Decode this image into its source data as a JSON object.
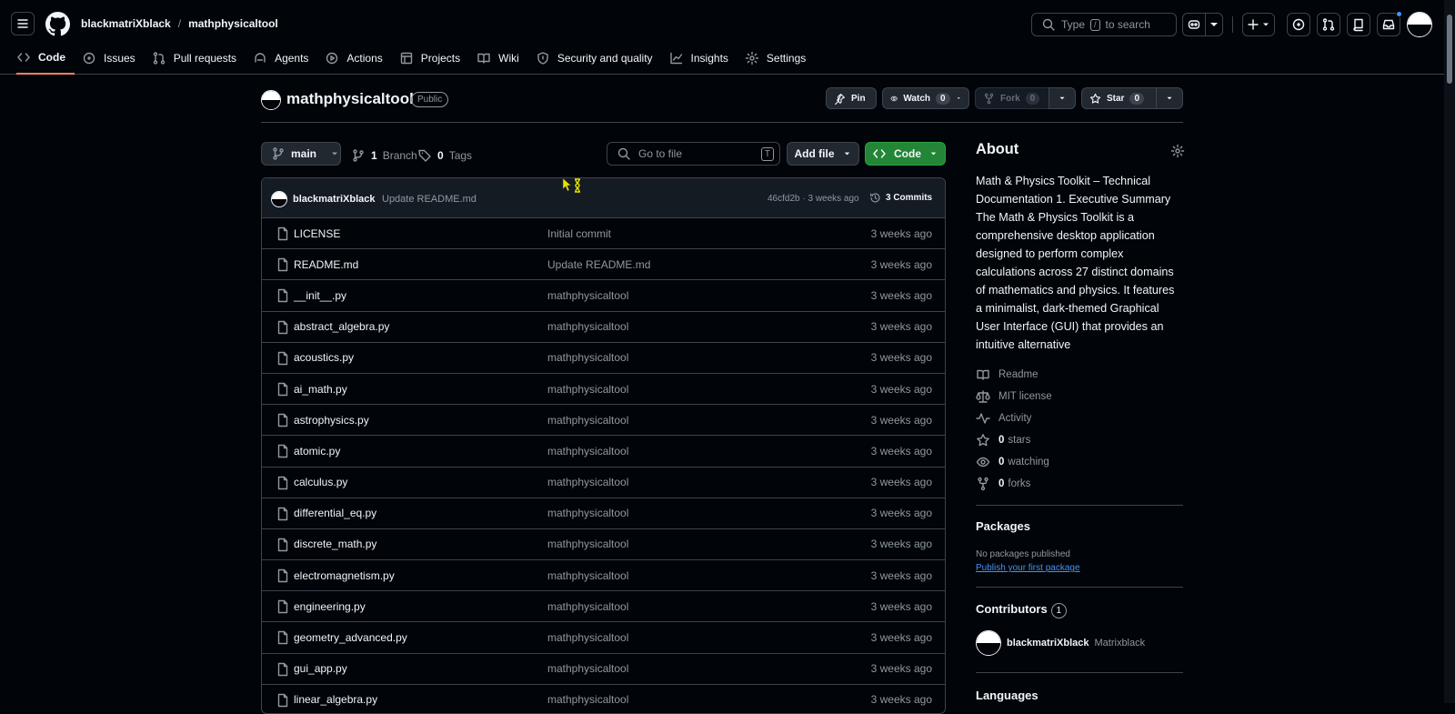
{
  "header": {
    "owner": "blackmatriXblack",
    "repo": "mathphysicaltool",
    "search_prefix": "Type",
    "search_key": "/",
    "search_suffix": "to search"
  },
  "tabs": [
    {
      "label": "Code"
    },
    {
      "label": "Issues"
    },
    {
      "label": "Pull requests"
    },
    {
      "label": "Agents"
    },
    {
      "label": "Actions"
    },
    {
      "label": "Projects"
    },
    {
      "label": "Wiki"
    },
    {
      "label": "Security and quality"
    },
    {
      "label": "Insights"
    },
    {
      "label": "Settings"
    }
  ],
  "repo": {
    "name": "mathphysicaltool",
    "visibility": "Public",
    "pin": "Pin",
    "watch": "Watch",
    "watch_count": "0",
    "fork": "Fork",
    "fork_count": "0",
    "star": "Star",
    "star_count": "0"
  },
  "toolbar": {
    "branch": "main",
    "branch_count": "1",
    "branch_label": "Branch",
    "tag_count": "0",
    "tag_label": "Tags",
    "goto_placeholder": "Go to file",
    "goto_key": "T",
    "add_file": "Add file",
    "code": "Code"
  },
  "latest_commit": {
    "author": "blackmatriXblack",
    "message": "Update README.md",
    "sha_age": "46cfd2b · 3 weeks ago",
    "commits": "3 Commits"
  },
  "files": [
    {
      "name": "LICENSE",
      "msg": "Initial commit",
      "date": "3 weeks ago"
    },
    {
      "name": "README.md",
      "msg": "Update README.md",
      "date": "3 weeks ago"
    },
    {
      "name": "__init__.py",
      "msg": "mathphysicaltool",
      "date": "3 weeks ago"
    },
    {
      "name": "abstract_algebra.py",
      "msg": "mathphysicaltool",
      "date": "3 weeks ago"
    },
    {
      "name": "acoustics.py",
      "msg": "mathphysicaltool",
      "date": "3 weeks ago"
    },
    {
      "name": "ai_math.py",
      "msg": "mathphysicaltool",
      "date": "3 weeks ago"
    },
    {
      "name": "astrophysics.py",
      "msg": "mathphysicaltool",
      "date": "3 weeks ago"
    },
    {
      "name": "atomic.py",
      "msg": "mathphysicaltool",
      "date": "3 weeks ago"
    },
    {
      "name": "calculus.py",
      "msg": "mathphysicaltool",
      "date": "3 weeks ago"
    },
    {
      "name": "differential_eq.py",
      "msg": "mathphysicaltool",
      "date": "3 weeks ago"
    },
    {
      "name": "discrete_math.py",
      "msg": "mathphysicaltool",
      "date": "3 weeks ago"
    },
    {
      "name": "electromagnetism.py",
      "msg": "mathphysicaltool",
      "date": "3 weeks ago"
    },
    {
      "name": "engineering.py",
      "msg": "mathphysicaltool",
      "date": "3 weeks ago"
    },
    {
      "name": "geometry_advanced.py",
      "msg": "mathphysicaltool",
      "date": "3 weeks ago"
    },
    {
      "name": "gui_app.py",
      "msg": "mathphysicaltool",
      "date": "3 weeks ago"
    },
    {
      "name": "linear_algebra.py",
      "msg": "mathphysicaltool",
      "date": "3 weeks ago"
    }
  ],
  "about": {
    "title": "About",
    "description": "Math & Physics Toolkit – Technical Documentation 1. Executive Summary The Math & Physics Toolkit is a comprehensive desktop application designed to perform complex calculations across 27 distinct domains of mathematics and physics. It features a minimalist, dark-themed Graphical User Interface (GUI) that provides an intuitive alternative",
    "readme": "Readme",
    "license": "MIT license",
    "activity": "Activity",
    "stars_count": "0",
    "stars_label": "stars",
    "watching_count": "0",
    "watching_label": "watching",
    "forks_count": "0",
    "forks_label": "forks"
  },
  "packages": {
    "title": "Packages",
    "none": "No packages published",
    "publish": "Publish your first package"
  },
  "contributors": {
    "title": "Contributors",
    "count": "1",
    "user": "blackmatriXblack",
    "name": "Matrixblack"
  },
  "languages": {
    "title": "Languages"
  },
  "colors": {
    "accent_tab": "#f78166",
    "code_button": "#238636",
    "link": "#4493f8"
  }
}
